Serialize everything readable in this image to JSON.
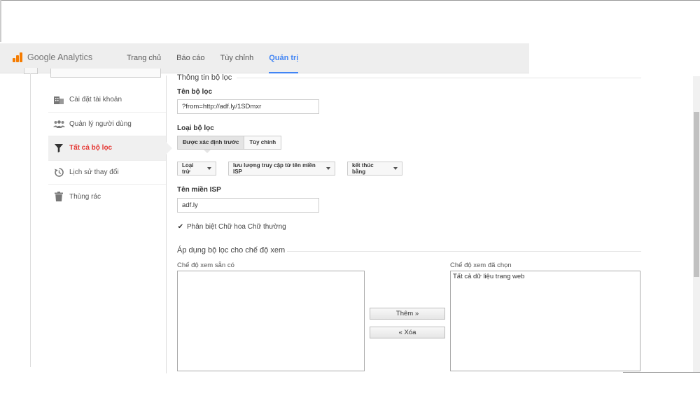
{
  "app": {
    "logo_text": "Google Analytics",
    "accent": "#4285f4",
    "logo_color": "#f57c00"
  },
  "nav": {
    "items": [
      {
        "label": "Trang chủ"
      },
      {
        "label": "Báo cáo"
      },
      {
        "label": "Tùy chỉnh"
      },
      {
        "label": "Quản trị",
        "active": true
      }
    ]
  },
  "sidebar": {
    "items": [
      {
        "label": "Cài đặt tài khoản",
        "icon": "building-icon"
      },
      {
        "label": "Quản lý người dùng",
        "icon": "users-icon"
      },
      {
        "label": "Tất cả bộ lọc",
        "icon": "filter-icon",
        "active": true
      },
      {
        "label": "Lịch sử thay đổi",
        "icon": "history-icon"
      },
      {
        "label": "Thùng rác",
        "icon": "trash-icon"
      }
    ]
  },
  "filter_info": {
    "section_title": "Thông tin bộ lọc",
    "name_label": "Tên bộ lọc",
    "name_value": "?from=http://adf.ly/1SDmxr",
    "type_label": "Loại bộ lọc",
    "type_options": [
      "Được xác định trước",
      "Tùy chỉnh"
    ],
    "dropdowns": [
      "Loại trừ",
      "lưu lượng truy cập từ tên miền ISP",
      "kết thúc bằng"
    ],
    "isp_label": "Tên miền ISP",
    "isp_value": "adf.ly",
    "case_sensitive_label": "Phân biệt Chữ hoa Chữ thường",
    "case_sensitive_checked": true
  },
  "apply_views": {
    "section_title": "Áp dụng bộ lọc cho chế độ xem",
    "available_label": "Chế độ xem sẵn có",
    "available_items": [],
    "selected_label": "Chế độ xem đã chọn",
    "selected_items": [
      "Tất cả dữ liệu trang web"
    ],
    "add_button": "Thêm »",
    "remove_button": "« Xóa"
  }
}
